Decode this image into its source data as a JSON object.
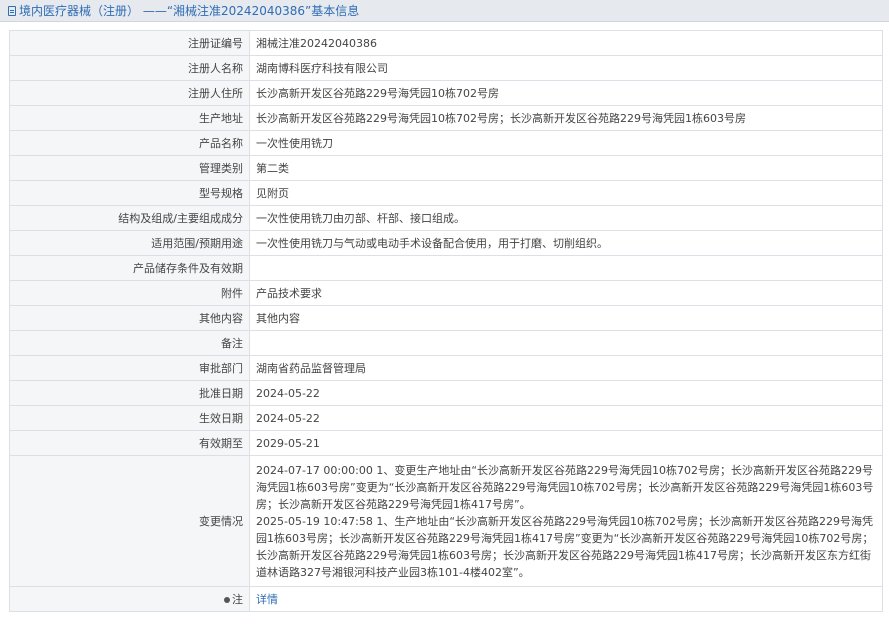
{
  "header": {
    "title": "境内医疗器械（注册） ——“湘械注准20242040386”基本信息"
  },
  "rows": [
    {
      "label": "注册证编号",
      "value": "湘械注准20242040386"
    },
    {
      "label": "注册人名称",
      "value": "湖南博科医疗科技有限公司"
    },
    {
      "label": "注册人住所",
      "value": "长沙高新开发区谷苑路229号海凭园10栋702号房"
    },
    {
      "label": "生产地址",
      "value": "长沙高新开发区谷苑路229号海凭园10栋702号房；长沙高新开发区谷苑路229号海凭园1栋603号房"
    },
    {
      "label": "产品名称",
      "value": "一次性使用铣刀"
    },
    {
      "label": "管理类别",
      "value": "第二类"
    },
    {
      "label": "型号规格",
      "value": "见附页"
    },
    {
      "label": "结构及组成/主要组成成分",
      "value": "一次性使用铣刀由刃部、杆部、接口组成。"
    },
    {
      "label": "适用范围/预期用途",
      "value": "一次性使用铣刀与气动或电动手术设备配合使用，用于打磨、切削组织。"
    },
    {
      "label": "产品储存条件及有效期",
      "value": ""
    },
    {
      "label": "附件",
      "value": "产品技术要求"
    },
    {
      "label": "其他内容",
      "value": "其他内容"
    },
    {
      "label": "备注",
      "value": ""
    },
    {
      "label": "审批部门",
      "value": "湖南省药品监督管理局"
    },
    {
      "label": "批准日期",
      "value": "2024-05-22"
    },
    {
      "label": "生效日期",
      "value": "2024-05-22"
    },
    {
      "label": "有效期至",
      "value": "2029-05-21"
    }
  ],
  "changes": {
    "label": "变更情况",
    "entries": [
      "2024-07-17 00:00:00 1、变更生产地址由“长沙高新开发区谷苑路229号海凭园10栋702号房；长沙高新开发区谷苑路229号海凭园1栋603号房”变更为“长沙高新开发区谷苑路229号海凭园10栋702号房；长沙高新开发区谷苑路229号海凭园1栋603号房；长沙高新开发区谷苑路229号海凭园1栋417号房”。",
      "2025-05-19 10:47:58 1、生产地址由“长沙高新开发区谷苑路229号海凭园10栋702号房；长沙高新开发区谷苑路229号海凭园1栋603号房；长沙高新开发区谷苑路229号海凭园1栋417号房”变更为“长沙高新开发区谷苑路229号海凭园10栋702号房；长沙高新开发区谷苑路229号海凭园1栋603号房；长沙高新开发区谷苑路229号海凭园1栋417号房；长沙高新开发区东方红街道林语路327号湘银河科技产业园3栋101-4楼402室”。"
    ]
  },
  "note": {
    "label": "注",
    "link_text": "详情"
  }
}
